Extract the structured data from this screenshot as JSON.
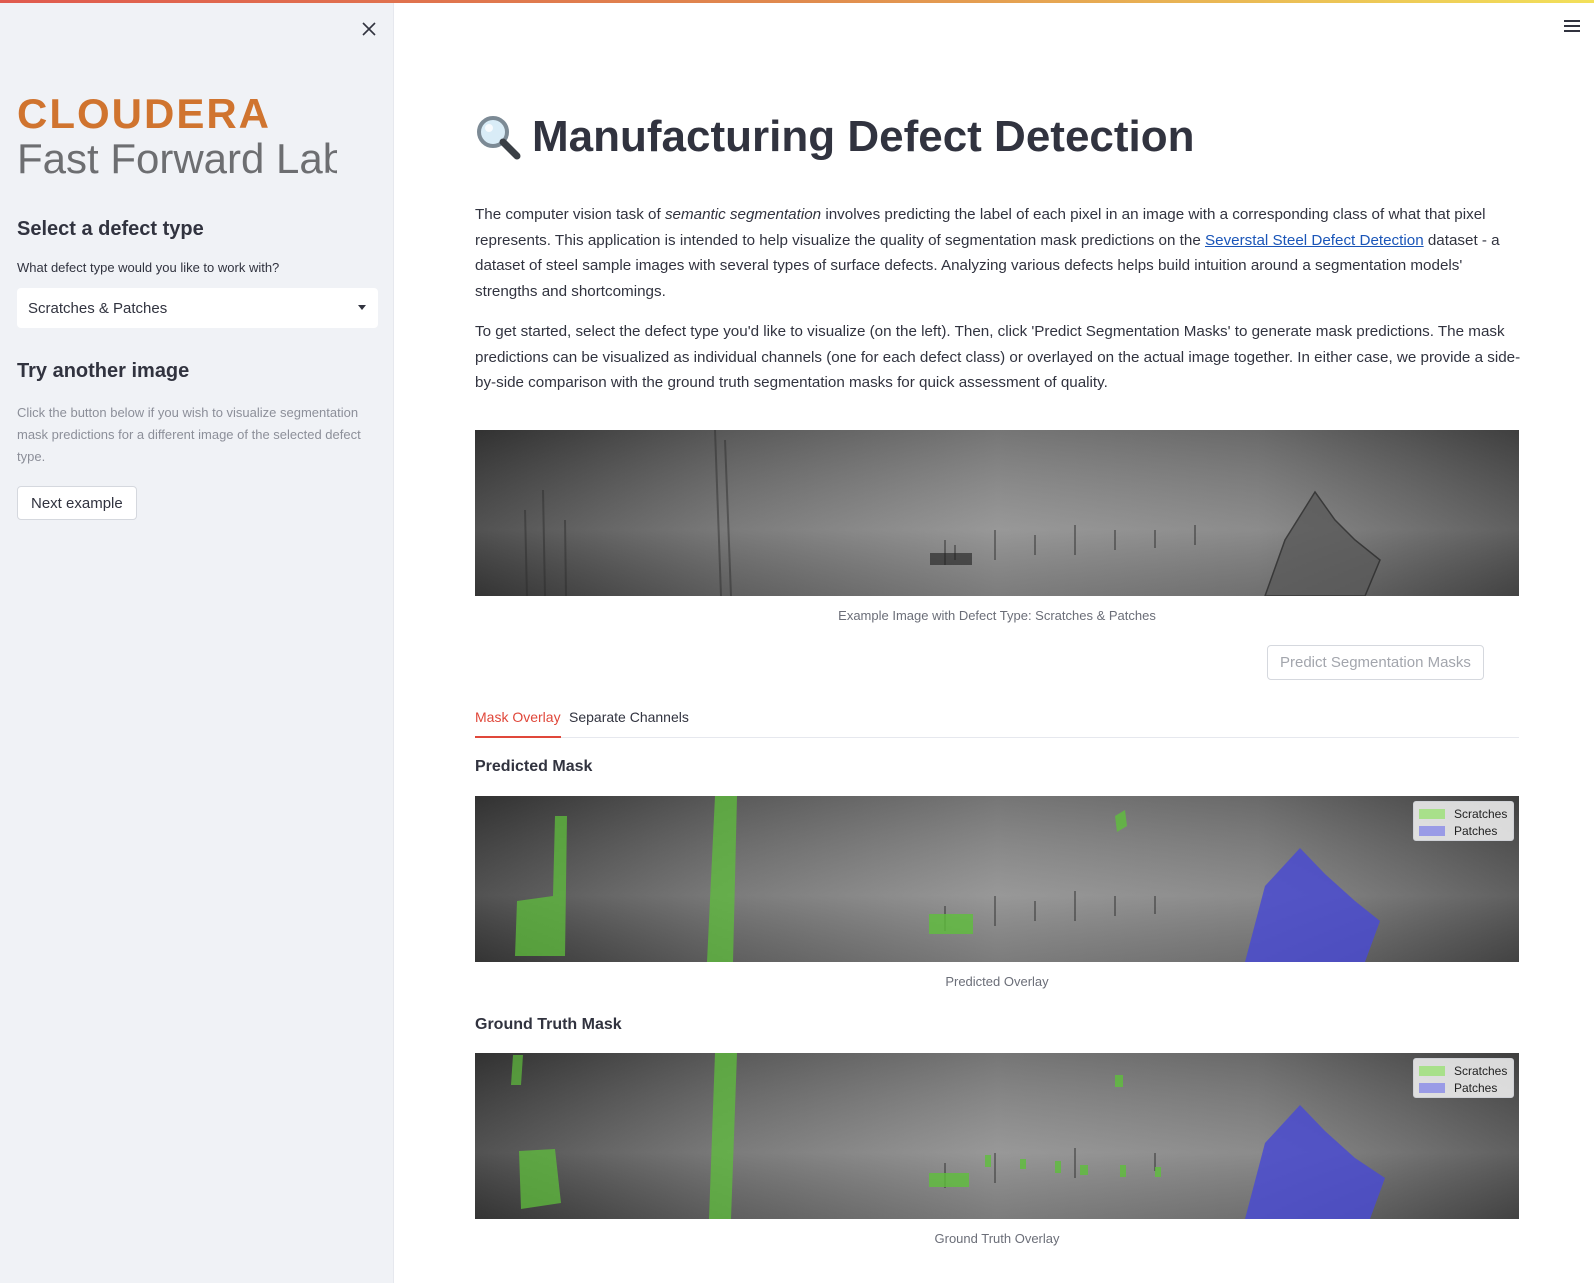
{
  "sidebar": {
    "logo_top": "CLOUDERA",
    "logo_bottom": "Fast Forward Labs",
    "section1_title": "Select a defect type",
    "select_label": "What defect type would you like to work with?",
    "select_value": "Scratches & Patches",
    "section2_title": "Try another image",
    "help_text": "Click the button below if you wish to visualize segmentation mask predictions for a different image of the selected defect type.",
    "next_button": "Next example"
  },
  "main": {
    "title": "Manufacturing Defect Detection",
    "para1_a": "The computer vision task of ",
    "para1_em": "semantic segmentation",
    "para1_b": " involves predicting the label of each pixel in an image with a corresponding class of what that pixel represents. This application is intended to help visualize the quality of segmentation mask predictions on the ",
    "para1_link": "Severstal Steel Defect Detection",
    "para1_c": " dataset - a dataset of steel sample images with several types of surface defects. Analyzing various defects helps build intuition around a segmentation models' strengths and shortcomings.",
    "para2": "To get started, select the defect type you'd like to visualize (on the left). Then, click 'Predict Segmentation Masks' to generate mask predictions. The mask predictions can be visualized as individual channels (one for each defect class) or overlayed on the actual image together. In either case, we provide a side-by-side comparison with the ground truth segmentation masks for quick assessment of quality.",
    "example_caption": "Example Image with Defect Type: Scratches & Patches",
    "predict_button": "Predict Segmentation Masks",
    "tabs": [
      {
        "label": "Mask Overlay",
        "active": true
      },
      {
        "label": "Separate Channels",
        "active": false
      }
    ],
    "predicted_title": "Predicted Mask",
    "predicted_caption": "Predicted Overlay",
    "truth_title": "Ground Truth Mask",
    "truth_caption": "Ground Truth Overlay",
    "legend": [
      {
        "label": "Scratches",
        "color": "#a8e08a"
      },
      {
        "label": "Patches",
        "color": "#9a9be6"
      }
    ]
  },
  "colors": {
    "accent": "#e0473a",
    "logo_orange": "#d0742f",
    "logo_gray": "#6d6e71",
    "link": "#1a55b8"
  }
}
